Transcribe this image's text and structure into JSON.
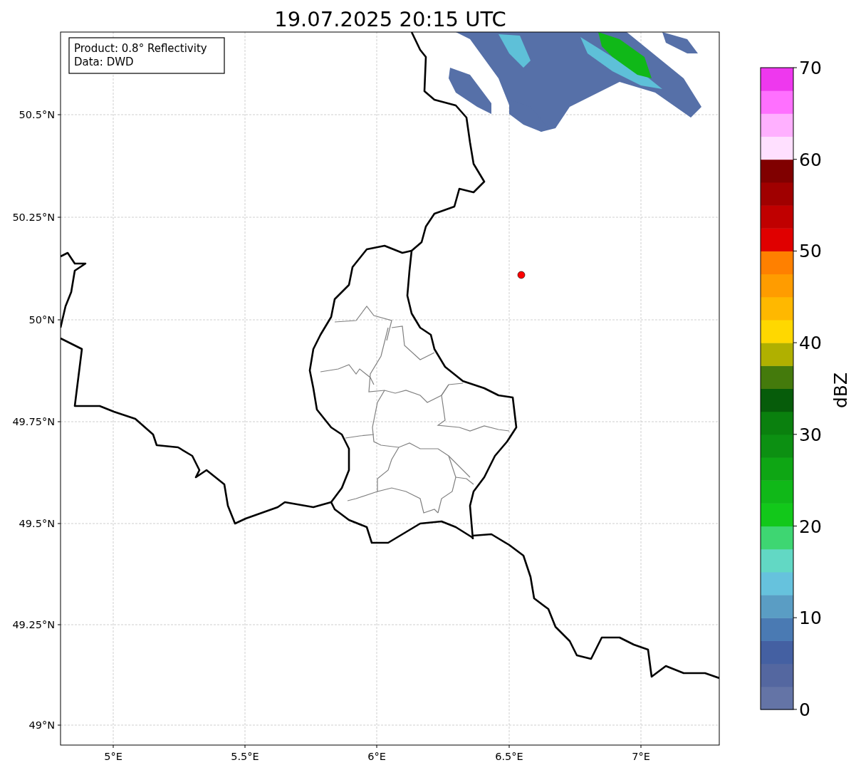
{
  "title": "19.07.2025 20:15 UTC",
  "info_box": {
    "lines": [
      "Product: 0.8° Reflectivity",
      "Data: DWD"
    ]
  },
  "map": {
    "lat_labels": [
      "50.5°N",
      "50.25°N",
      "50°N",
      "49.75°N",
      "49.5°N",
      "49.25°N",
      "49°N"
    ],
    "lon_labels": [
      "5°E",
      "5.5°E",
      "6°E",
      "6.5°E",
      "7°E"
    ]
  },
  "colorbar": {
    "label": "dBZ",
    "ticks": [
      "70",
      "60",
      "50",
      "40",
      "30",
      "20",
      "10",
      "0"
    ],
    "bands": [
      {
        "color": "#6474a6"
      },
      {
        "color": "#5467a0"
      },
      {
        "color": "#4460a2"
      },
      {
        "color": "#4a7ab3"
      },
      {
        "color": "#5a9dc4"
      },
      {
        "color": "#66c2dd"
      },
      {
        "color": "#62d8c4"
      },
      {
        "color": "#3ed672"
      },
      {
        "color": "#12c81a"
      },
      {
        "color": "#10b818"
      },
      {
        "color": "#0ea614"
      },
      {
        "color": "#0c9012"
      },
      {
        "color": "#0a800e"
      },
      {
        "color": "#065c0a"
      },
      {
        "color": "#447a0c"
      },
      {
        "color": "#b0b000"
      },
      {
        "color": "#ffd800"
      },
      {
        "color": "#ffb800"
      },
      {
        "color": "#ff9c00"
      },
      {
        "color": "#ff8000"
      },
      {
        "color": "#e00000"
      },
      {
        "color": "#c00000"
      },
      {
        "color": "#a00000"
      },
      {
        "color": "#800000"
      },
      {
        "color": "#ffe0ff"
      },
      {
        "color": "#ffb0ff"
      },
      {
        "color": "#ff70ff"
      },
      {
        "color": "#ee38ee"
      }
    ]
  }
}
